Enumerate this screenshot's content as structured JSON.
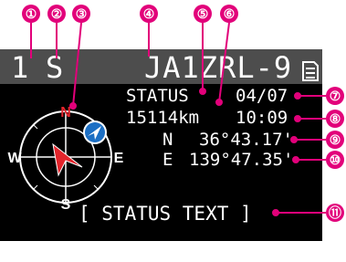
{
  "callouts": [
    "①",
    "②",
    "③",
    "④",
    "⑤",
    "⑥",
    "⑦",
    "⑧",
    "⑨",
    "⑩",
    "⑪"
  ],
  "header": {
    "channel": "1",
    "mode": "S",
    "callsign": "JA1ZRL-9"
  },
  "info": {
    "status_label": "STATUS",
    "date": "04/07",
    "distance": "15114km",
    "time": "10:09",
    "lat_dir": "N",
    "lat_value": "36°43.17'",
    "lon_dir": "E",
    "lon_value": "139°47.35'"
  },
  "compass": {
    "north": "N",
    "east": "E",
    "south": "S",
    "west": "W"
  },
  "status_text": "[ STATUS TEXT ]",
  "colors": {
    "accent": "#e2007a",
    "screen_bg": "#000000",
    "header_bg": "#4d4d4d",
    "north_marker": "#e3242b",
    "arrow_red": "#e3242b",
    "nav_icon_bg": "#1c6fc4"
  },
  "icons": {
    "header_right": "memory-card-icon",
    "nav": "navigation-arrow-icon",
    "heading": "heading-arrow-icon"
  }
}
